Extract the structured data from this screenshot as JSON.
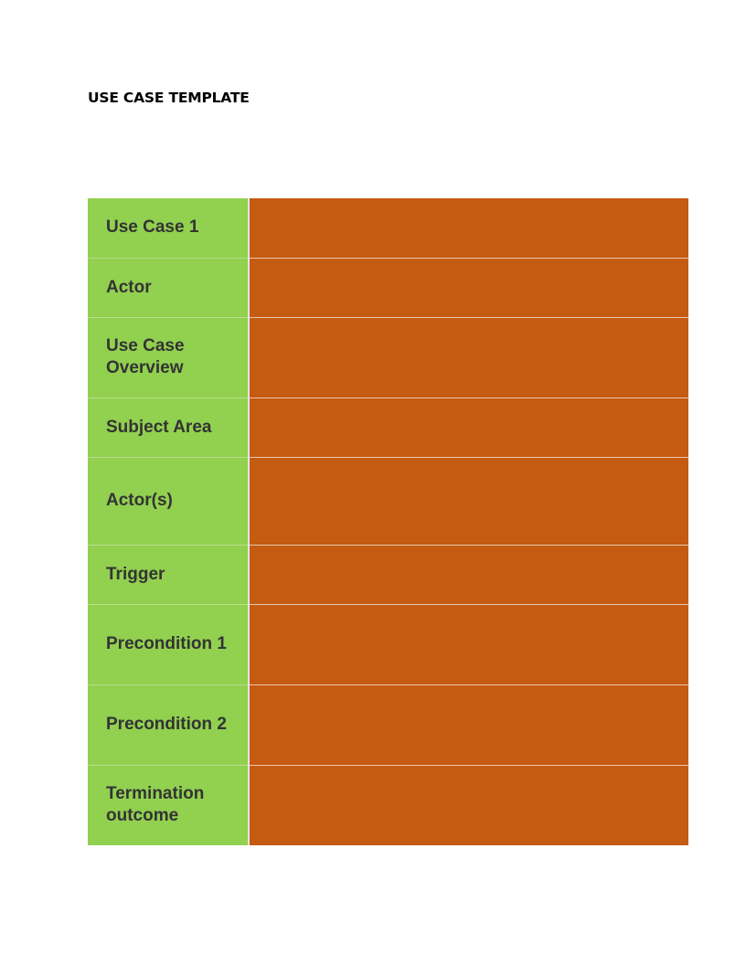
{
  "document": {
    "title": "USE CASE TEMPLATE"
  },
  "table": {
    "label_color": "#92d050",
    "value_color": "#c55a11",
    "rows": [
      {
        "label": "Use Case 1",
        "value": ""
      },
      {
        "label": "Actor",
        "value": ""
      },
      {
        "label": "Use Case Overview",
        "value": ""
      },
      {
        "label": "Subject Area",
        "value": ""
      },
      {
        "label": "Actor(s)",
        "value": ""
      },
      {
        "label": "Trigger",
        "value": ""
      },
      {
        "label": "Precondition 1",
        "value": ""
      },
      {
        "label": "Precondition 2",
        "value": ""
      },
      {
        "label": "Termination outcome",
        "value": ""
      }
    ]
  }
}
